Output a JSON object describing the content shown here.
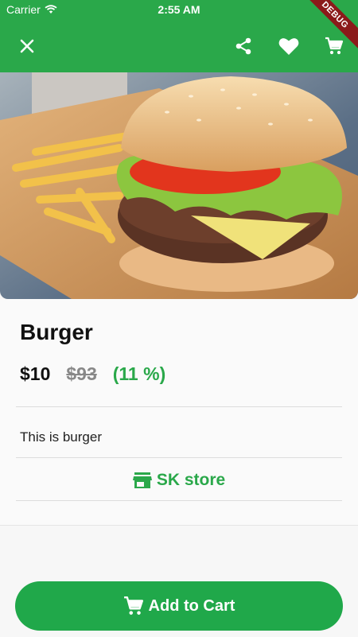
{
  "status_bar": {
    "carrier": "Carrier",
    "time": "2:55 AM"
  },
  "debug_banner": "DEBUG",
  "toolbar": {
    "icons": [
      "close-icon",
      "share-icon",
      "heart-icon",
      "cart-icon"
    ]
  },
  "product": {
    "title": "Burger",
    "price": "$10",
    "old_price": "$93",
    "discount": "(11 %)",
    "description": "This is burger",
    "store_name": "SK store"
  },
  "actions": {
    "add_to_cart_label": "Add to Cart"
  },
  "colors": {
    "primary": "#2aa84a",
    "button": "#20a84a",
    "debug": "#8b1a1a"
  }
}
